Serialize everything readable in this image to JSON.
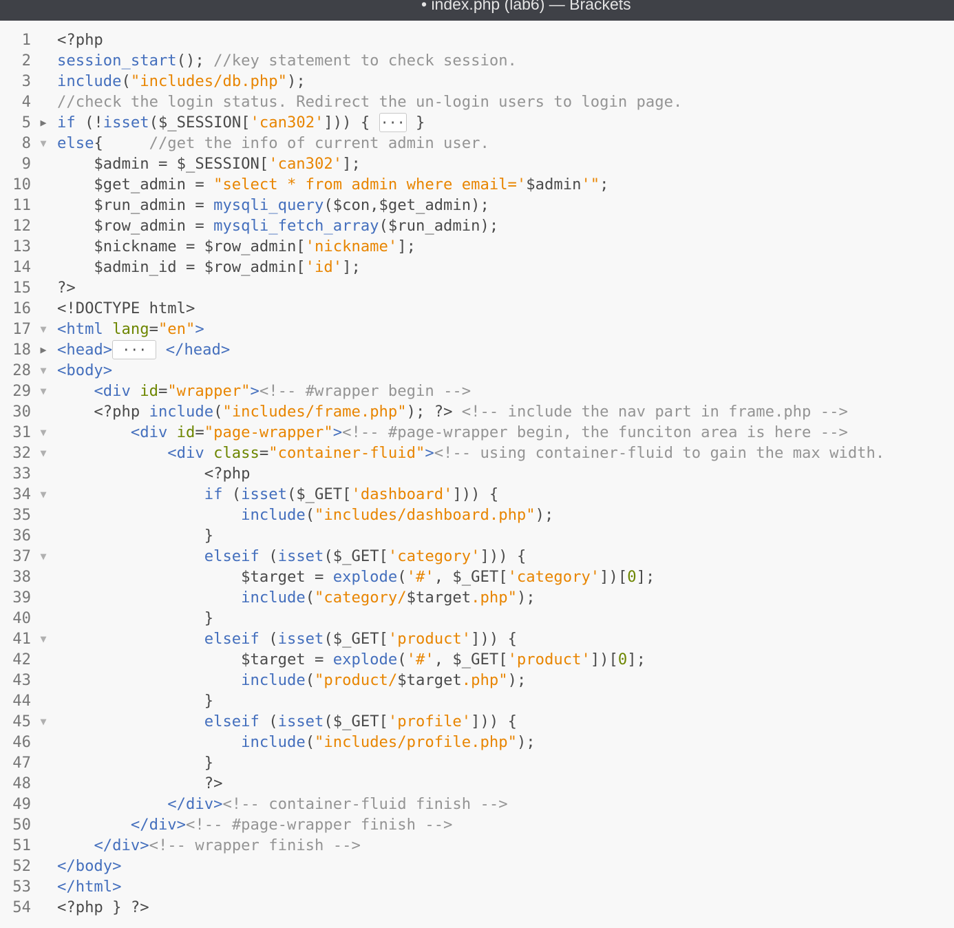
{
  "window": {
    "title": "• index.php (lab6) — Brackets"
  },
  "colors": {
    "keyword": "#446fbd",
    "string": "#e88501",
    "comment": "#949494",
    "attribute": "#6d8600",
    "plain": "#4a4a4a",
    "background": "#f8f8f8",
    "titlebar": "#3f4147"
  },
  "editor": {
    "language": "php",
    "lines": [
      {
        "n": "1",
        "fold": "",
        "tokens": [
          {
            "c": "t-plain",
            "t": "<?php"
          }
        ]
      },
      {
        "n": "2",
        "fold": "",
        "tokens": [
          {
            "c": "t-fn",
            "t": "session_start"
          },
          {
            "c": "t-plain",
            "t": "(); "
          },
          {
            "c": "t-com",
            "t": "//key statement to check session."
          }
        ]
      },
      {
        "n": "3",
        "fold": "",
        "tokens": [
          {
            "c": "t-kw",
            "t": "include"
          },
          {
            "c": "t-plain",
            "t": "("
          },
          {
            "c": "t-str",
            "t": "\"includes/db.php\""
          },
          {
            "c": "t-plain",
            "t": ");"
          }
        ]
      },
      {
        "n": "4",
        "fold": "",
        "tokens": [
          {
            "c": "t-com",
            "t": "//check the login status. Redirect the un-login users to login page."
          }
        ]
      },
      {
        "n": "5",
        "fold": "closed",
        "tokens": [
          {
            "c": "t-kw",
            "t": "if"
          },
          {
            "c": "t-plain",
            "t": " (!"
          },
          {
            "c": "t-fn",
            "t": "isset"
          },
          {
            "c": "t-plain",
            "t": "($_SESSION["
          },
          {
            "c": "t-str",
            "t": "'can302'"
          },
          {
            "c": "t-plain",
            "t": "])) { "
          },
          {
            "c": "t-fold",
            "t": "···"
          },
          {
            "c": "t-plain",
            "t": " }"
          }
        ]
      },
      {
        "n": "8",
        "fold": "open",
        "tokens": [
          {
            "c": "t-kw",
            "t": "else"
          },
          {
            "c": "t-plain",
            "t": "{     "
          },
          {
            "c": "t-com",
            "t": "//get the info of current admin user."
          }
        ]
      },
      {
        "n": "9",
        "fold": "",
        "tokens": [
          {
            "c": "t-plain",
            "t": "    $admin = $_SESSION["
          },
          {
            "c": "t-str",
            "t": "'can302'"
          },
          {
            "c": "t-plain",
            "t": "];"
          }
        ]
      },
      {
        "n": "10",
        "fold": "",
        "tokens": [
          {
            "c": "t-plain",
            "t": "    $get_admin = "
          },
          {
            "c": "t-str",
            "t": "\"select * from admin where email='"
          },
          {
            "c": "t-plain",
            "t": "$admin"
          },
          {
            "c": "t-str",
            "t": "'\""
          },
          {
            "c": "t-plain",
            "t": ";"
          }
        ]
      },
      {
        "n": "11",
        "fold": "",
        "tokens": [
          {
            "c": "t-plain",
            "t": "    $run_admin = "
          },
          {
            "c": "t-fn",
            "t": "mysqli_query"
          },
          {
            "c": "t-plain",
            "t": "($con,$get_admin);"
          }
        ]
      },
      {
        "n": "12",
        "fold": "",
        "tokens": [
          {
            "c": "t-plain",
            "t": "    $row_admin = "
          },
          {
            "c": "t-fn",
            "t": "mysqli_fetch_array"
          },
          {
            "c": "t-plain",
            "t": "($run_admin);"
          }
        ]
      },
      {
        "n": "13",
        "fold": "",
        "tokens": [
          {
            "c": "t-plain",
            "t": "    $nickname = $row_admin["
          },
          {
            "c": "t-str",
            "t": "'nickname'"
          },
          {
            "c": "t-plain",
            "t": "];"
          }
        ]
      },
      {
        "n": "14",
        "fold": "",
        "tokens": [
          {
            "c": "t-plain",
            "t": "    $admin_id = $row_admin["
          },
          {
            "c": "t-str",
            "t": "'id'"
          },
          {
            "c": "t-plain",
            "t": "];"
          }
        ]
      },
      {
        "n": "15",
        "fold": "",
        "tokens": [
          {
            "c": "t-plain",
            "t": "?>"
          }
        ]
      },
      {
        "n": "16",
        "fold": "",
        "tokens": [
          {
            "c": "t-plain",
            "t": "<!DOCTYPE html>"
          }
        ]
      },
      {
        "n": "17",
        "fold": "open",
        "tokens": [
          {
            "c": "t-tag",
            "t": "<html"
          },
          {
            "c": "t-plain",
            "t": " "
          },
          {
            "c": "t-attr",
            "t": "lang"
          },
          {
            "c": "t-plain",
            "t": "="
          },
          {
            "c": "t-str",
            "t": "\"en\""
          },
          {
            "c": "t-tag",
            "t": ">"
          }
        ]
      },
      {
        "n": "18",
        "fold": "closed",
        "tokens": [
          {
            "c": "t-tag",
            "t": "<head>"
          },
          {
            "c": "t-fold",
            "t": " ··· "
          },
          {
            "c": "t-plain",
            "t": " "
          },
          {
            "c": "t-tag",
            "t": "</head>"
          }
        ]
      },
      {
        "n": "28",
        "fold": "open",
        "tokens": [
          {
            "c": "t-tag",
            "t": "<body>"
          }
        ]
      },
      {
        "n": "29",
        "fold": "open",
        "tokens": [
          {
            "c": "t-plain",
            "t": "    "
          },
          {
            "c": "t-tag",
            "t": "<div"
          },
          {
            "c": "t-plain",
            "t": " "
          },
          {
            "c": "t-attr",
            "t": "id"
          },
          {
            "c": "t-plain",
            "t": "="
          },
          {
            "c": "t-str",
            "t": "\"wrapper\""
          },
          {
            "c": "t-tag",
            "t": ">"
          },
          {
            "c": "t-com",
            "t": "<!-- #wrapper begin -->"
          }
        ]
      },
      {
        "n": "30",
        "fold": "",
        "tokens": [
          {
            "c": "t-plain",
            "t": "    <?php "
          },
          {
            "c": "t-kw",
            "t": "include"
          },
          {
            "c": "t-plain",
            "t": "("
          },
          {
            "c": "t-str",
            "t": "\"includes/frame.php\""
          },
          {
            "c": "t-plain",
            "t": "); ?> "
          },
          {
            "c": "t-com",
            "t": "<!-- include the nav part in frame.php -->"
          }
        ]
      },
      {
        "n": "31",
        "fold": "open",
        "tokens": [
          {
            "c": "t-plain",
            "t": "        "
          },
          {
            "c": "t-tag",
            "t": "<div"
          },
          {
            "c": "t-plain",
            "t": " "
          },
          {
            "c": "t-attr",
            "t": "id"
          },
          {
            "c": "t-plain",
            "t": "="
          },
          {
            "c": "t-str",
            "t": "\"page-wrapper\""
          },
          {
            "c": "t-tag",
            "t": ">"
          },
          {
            "c": "t-com",
            "t": "<!-- #page-wrapper begin, the funciton area is here -->"
          }
        ]
      },
      {
        "n": "32",
        "fold": "open",
        "tokens": [
          {
            "c": "t-plain",
            "t": "            "
          },
          {
            "c": "t-tag",
            "t": "<div"
          },
          {
            "c": "t-plain",
            "t": " "
          },
          {
            "c": "t-attr",
            "t": "class"
          },
          {
            "c": "t-plain",
            "t": "="
          },
          {
            "c": "t-str",
            "t": "\"container-fluid\""
          },
          {
            "c": "t-tag",
            "t": ">"
          },
          {
            "c": "t-com",
            "t": "<!-- using container-fluid to gain the max width."
          }
        ]
      },
      {
        "n": "33",
        "fold": "",
        "tokens": [
          {
            "c": "t-plain",
            "t": "                <?php"
          }
        ]
      },
      {
        "n": "34",
        "fold": "open",
        "tokens": [
          {
            "c": "t-plain",
            "t": "                "
          },
          {
            "c": "t-kw",
            "t": "if"
          },
          {
            "c": "t-plain",
            "t": " ("
          },
          {
            "c": "t-fn",
            "t": "isset"
          },
          {
            "c": "t-plain",
            "t": "($_GET["
          },
          {
            "c": "t-str",
            "t": "'dashboard'"
          },
          {
            "c": "t-plain",
            "t": "])) {"
          }
        ]
      },
      {
        "n": "35",
        "fold": "",
        "tokens": [
          {
            "c": "t-plain",
            "t": "                    "
          },
          {
            "c": "t-kw",
            "t": "include"
          },
          {
            "c": "t-plain",
            "t": "("
          },
          {
            "c": "t-str",
            "t": "\"includes/dashboard.php\""
          },
          {
            "c": "t-plain",
            "t": ");"
          }
        ]
      },
      {
        "n": "36",
        "fold": "",
        "tokens": [
          {
            "c": "t-plain",
            "t": "                }"
          }
        ]
      },
      {
        "n": "37",
        "fold": "open",
        "tokens": [
          {
            "c": "t-plain",
            "t": "                "
          },
          {
            "c": "t-kw",
            "t": "elseif"
          },
          {
            "c": "t-plain",
            "t": " ("
          },
          {
            "c": "t-fn",
            "t": "isset"
          },
          {
            "c": "t-plain",
            "t": "($_GET["
          },
          {
            "c": "t-str",
            "t": "'category'"
          },
          {
            "c": "t-plain",
            "t": "])) {"
          }
        ]
      },
      {
        "n": "38",
        "fold": "",
        "tokens": [
          {
            "c": "t-plain",
            "t": "                    $target = "
          },
          {
            "c": "t-fn",
            "t": "explode"
          },
          {
            "c": "t-plain",
            "t": "("
          },
          {
            "c": "t-str",
            "t": "'#'"
          },
          {
            "c": "t-plain",
            "t": ", $_GET["
          },
          {
            "c": "t-str",
            "t": "'category'"
          },
          {
            "c": "t-plain",
            "t": "])["
          },
          {
            "c": "t-attr",
            "t": "0"
          },
          {
            "c": "t-plain",
            "t": "];"
          }
        ]
      },
      {
        "n": "39",
        "fold": "",
        "tokens": [
          {
            "c": "t-plain",
            "t": "                    "
          },
          {
            "c": "t-kw",
            "t": "include"
          },
          {
            "c": "t-plain",
            "t": "("
          },
          {
            "c": "t-str",
            "t": "\"category/"
          },
          {
            "c": "t-plain",
            "t": "$target"
          },
          {
            "c": "t-str",
            "t": ".php\""
          },
          {
            "c": "t-plain",
            "t": ");"
          }
        ]
      },
      {
        "n": "40",
        "fold": "",
        "tokens": [
          {
            "c": "t-plain",
            "t": "                }"
          }
        ]
      },
      {
        "n": "41",
        "fold": "open",
        "tokens": [
          {
            "c": "t-plain",
            "t": "                "
          },
          {
            "c": "t-kw",
            "t": "elseif"
          },
          {
            "c": "t-plain",
            "t": " ("
          },
          {
            "c": "t-fn",
            "t": "isset"
          },
          {
            "c": "t-plain",
            "t": "($_GET["
          },
          {
            "c": "t-str",
            "t": "'product'"
          },
          {
            "c": "t-plain",
            "t": "])) {"
          }
        ]
      },
      {
        "n": "42",
        "fold": "",
        "tokens": [
          {
            "c": "t-plain",
            "t": "                    $target = "
          },
          {
            "c": "t-fn",
            "t": "explode"
          },
          {
            "c": "t-plain",
            "t": "("
          },
          {
            "c": "t-str",
            "t": "'#'"
          },
          {
            "c": "t-plain",
            "t": ", $_GET["
          },
          {
            "c": "t-str",
            "t": "'product'"
          },
          {
            "c": "t-plain",
            "t": "])["
          },
          {
            "c": "t-attr",
            "t": "0"
          },
          {
            "c": "t-plain",
            "t": "];"
          }
        ]
      },
      {
        "n": "43",
        "fold": "",
        "tokens": [
          {
            "c": "t-plain",
            "t": "                    "
          },
          {
            "c": "t-kw",
            "t": "include"
          },
          {
            "c": "t-plain",
            "t": "("
          },
          {
            "c": "t-str",
            "t": "\"product/"
          },
          {
            "c": "t-plain",
            "t": "$target"
          },
          {
            "c": "t-str",
            "t": ".php\""
          },
          {
            "c": "t-plain",
            "t": ");"
          }
        ]
      },
      {
        "n": "44",
        "fold": "",
        "tokens": [
          {
            "c": "t-plain",
            "t": "                }"
          }
        ]
      },
      {
        "n": "45",
        "fold": "open",
        "tokens": [
          {
            "c": "t-plain",
            "t": "                "
          },
          {
            "c": "t-kw",
            "t": "elseif"
          },
          {
            "c": "t-plain",
            "t": " ("
          },
          {
            "c": "t-fn",
            "t": "isset"
          },
          {
            "c": "t-plain",
            "t": "($_GET["
          },
          {
            "c": "t-str",
            "t": "'profile'"
          },
          {
            "c": "t-plain",
            "t": "])) {"
          }
        ]
      },
      {
        "n": "46",
        "fold": "",
        "tokens": [
          {
            "c": "t-plain",
            "t": "                    "
          },
          {
            "c": "t-kw",
            "t": "include"
          },
          {
            "c": "t-plain",
            "t": "("
          },
          {
            "c": "t-str",
            "t": "\"includes/profile.php\""
          },
          {
            "c": "t-plain",
            "t": ");"
          }
        ]
      },
      {
        "n": "47",
        "fold": "",
        "tokens": [
          {
            "c": "t-plain",
            "t": "                }"
          }
        ]
      },
      {
        "n": "48",
        "fold": "",
        "tokens": [
          {
            "c": "t-plain",
            "t": "                ?>"
          }
        ]
      },
      {
        "n": "49",
        "fold": "",
        "tokens": [
          {
            "c": "t-plain",
            "t": "            "
          },
          {
            "c": "t-tag",
            "t": "</div>"
          },
          {
            "c": "t-com",
            "t": "<!-- container-fluid finish -->"
          }
        ]
      },
      {
        "n": "50",
        "fold": "",
        "tokens": [
          {
            "c": "t-plain",
            "t": "        "
          },
          {
            "c": "t-tag",
            "t": "</div>"
          },
          {
            "c": "t-com",
            "t": "<!-- #page-wrapper finish -->"
          }
        ]
      },
      {
        "n": "51",
        "fold": "",
        "tokens": [
          {
            "c": "t-plain",
            "t": "    "
          },
          {
            "c": "t-tag",
            "t": "</div>"
          },
          {
            "c": "t-com",
            "t": "<!-- wrapper finish -->"
          }
        ]
      },
      {
        "n": "52",
        "fold": "",
        "tokens": [
          {
            "c": "t-tag",
            "t": "</body>"
          }
        ]
      },
      {
        "n": "53",
        "fold": "",
        "tokens": [
          {
            "c": "t-tag",
            "t": "</html>"
          }
        ]
      },
      {
        "n": "54",
        "fold": "",
        "tokens": [
          {
            "c": "t-plain",
            "t": "<?php } ?>"
          }
        ]
      }
    ]
  }
}
